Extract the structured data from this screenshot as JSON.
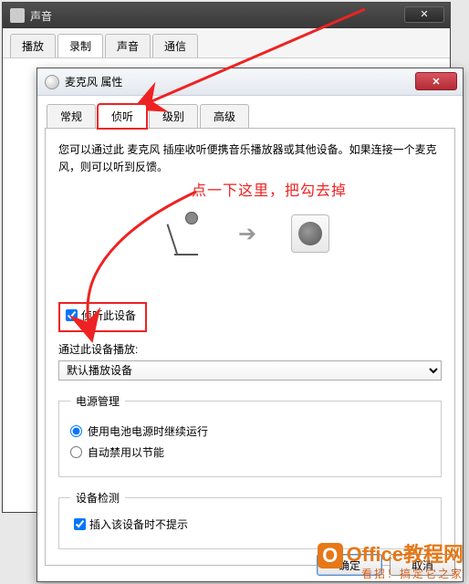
{
  "back": {
    "title": "声音",
    "tabs": [
      "播放",
      "录制",
      "声音",
      "通信"
    ],
    "active_tab": 1,
    "close_glyph": "✕"
  },
  "front": {
    "title": "麦克风 属性",
    "tabs": [
      "常规",
      "侦听",
      "级别",
      "高级"
    ],
    "active_tab": 1,
    "desc": "您可以通过此 麦克风 插座收听便携音乐播放器或其他设备。如果连接一个麦克风，则可以听到反馈。",
    "listen_checkbox": {
      "label": "侦听此设备",
      "checked": true
    },
    "playback_label": "通过此设备播放:",
    "playback_selected": "默认播放设备",
    "power": {
      "legend": "电源管理",
      "opt_keep": "使用电池电源时继续运行",
      "opt_auto": "自动禁用以节能",
      "selected": "keep"
    },
    "detection": {
      "legend": "设备检测",
      "label": "插入该设备时不提示",
      "checked": true
    },
    "buttons": {
      "ok": "确定",
      "cancel": "取消"
    }
  },
  "annotation": {
    "text": "点一下这里，把勾去掉"
  },
  "watermark": {
    "line1": "Office教程网",
    "line2": "看招！搞定它之家"
  }
}
